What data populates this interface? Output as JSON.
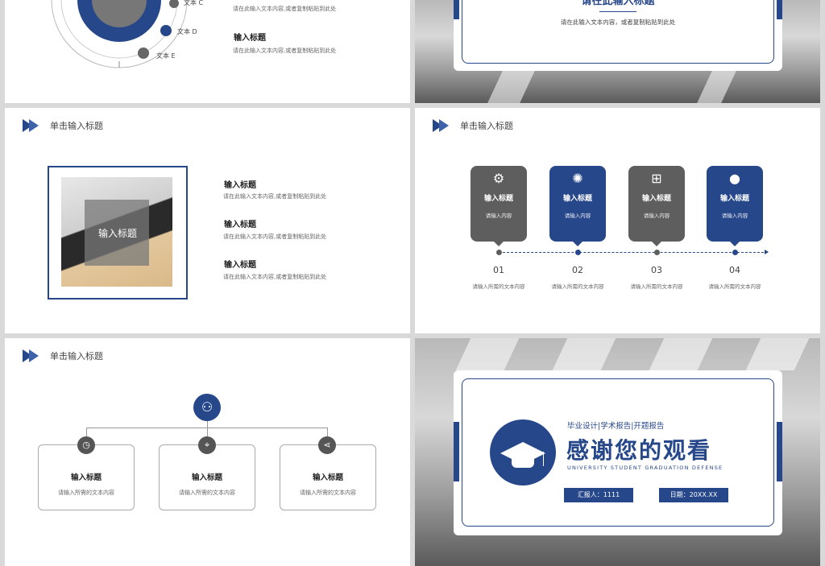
{
  "slide1": {
    "legend": [
      {
        "label": "文本 C"
      },
      {
        "label": "文本 D"
      },
      {
        "label": "文本 E"
      }
    ],
    "body_top": "请在此输入文本内容,或者复制粘贴到此处",
    "title2": "输入标题",
    "body2": "请在此输入文本内容,或者复制粘贴到此处"
  },
  "slide2": {
    "title_partial": "请在此输入标题",
    "body": "请在此输入文本内容，或者复制粘贴到此处"
  },
  "slide3": {
    "header": "单击输入标题",
    "photo_caption": "输入标题",
    "items": [
      {
        "title": "输入标题",
        "body": "请在此输入文本内容,或者复制粘贴到此处"
      },
      {
        "title": "输入标题",
        "body": "请在此输入文本内容,或者复制粘贴到此处"
      },
      {
        "title": "输入标题",
        "body": "请在此输入文本内容,或者复制粘贴到此处"
      }
    ]
  },
  "slide4": {
    "header": "单击输入标题",
    "cards": [
      {
        "title": "输入标题",
        "body": "请输入内容",
        "icon": "gear-icon",
        "color": "#5e5e5e"
      },
      {
        "title": "输入标题",
        "body": "请输入内容",
        "icon": "aperture-icon",
        "color": "#26478a"
      },
      {
        "title": "输入标题",
        "body": "请输入内容",
        "icon": "windows-icon",
        "color": "#5e5e5e"
      },
      {
        "title": "输入标题",
        "body": "请输入内容",
        "icon": "apple-icon",
        "color": "#26478a"
      }
    ],
    "steps": [
      {
        "num": "01",
        "text": "请输入所需的文本内容"
      },
      {
        "num": "02",
        "text": "请输入所需的文本内容"
      },
      {
        "num": "03",
        "text": "请输入所需的文本内容"
      },
      {
        "num": "04",
        "text": "请输入所需的文本内容"
      }
    ]
  },
  "slide5": {
    "header": "单击输入标题",
    "boxes": [
      {
        "title": "输入标题",
        "body": "请输入所需的文本内容",
        "icon": "clock-icon"
      },
      {
        "title": "输入标题",
        "body": "请输入所需的文本内容",
        "icon": "location-pin-icon"
      },
      {
        "title": "输入标题",
        "body": "请输入所需的文本内容",
        "icon": "share-icon"
      }
    ],
    "top_icon": "user-icon"
  },
  "slide6": {
    "subtitle": "毕业设计|学术报告|开题报告",
    "title": "感谢您的观看",
    "english": "UNIVERSITY STUDENT GRADUATION DEFENSE",
    "reporter": "汇报人：1111",
    "date": "日期：20XX.XX",
    "icon": "graduation-cap-icon"
  },
  "colors": {
    "accent": "#26478a",
    "gray": "#5e5e5e"
  }
}
